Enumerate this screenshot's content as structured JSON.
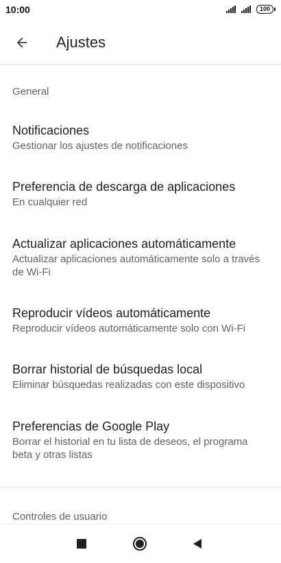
{
  "status_bar": {
    "time": "10:00",
    "battery": "100"
  },
  "app_bar": {
    "title": "Ajustes",
    "back_icon": "arrow-back-icon"
  },
  "sections": [
    {
      "header": "General",
      "items": [
        {
          "title": "Notificaciones",
          "subtitle": "Gestionar los ajustes de notificaciones"
        },
        {
          "title": "Preferencia de descarga de aplicaciones",
          "subtitle": "En cualquier red"
        },
        {
          "title": "Actualizar aplicaciones automáticamente",
          "subtitle": "Actualizar aplicaciones automáticamente solo a través de Wi-Fi"
        },
        {
          "title": "Reproducir vídeos automáticamente",
          "subtitle": "Reproducir vídeos automáticamente solo con Wi-Fi"
        },
        {
          "title": "Borrar historial de búsquedas local",
          "subtitle": "Eliminar búsquedas realizadas con este dispositivo"
        },
        {
          "title": "Preferencias de Google Play",
          "subtitle": "Borrar el historial en tu lista de deseos, el programa beta y otras listas"
        }
      ]
    },
    {
      "header": "Controles de usuario",
      "items": []
    }
  ],
  "nav_bar": {
    "recents_icon": "square-recents-icon",
    "home_icon": "circle-home-icon",
    "back_icon": "triangle-back-icon"
  },
  "colors": {
    "text_primary": "#202124",
    "text_secondary": "#5f6368",
    "divider": "#e6e6e6",
    "background": "#ffffff"
  }
}
